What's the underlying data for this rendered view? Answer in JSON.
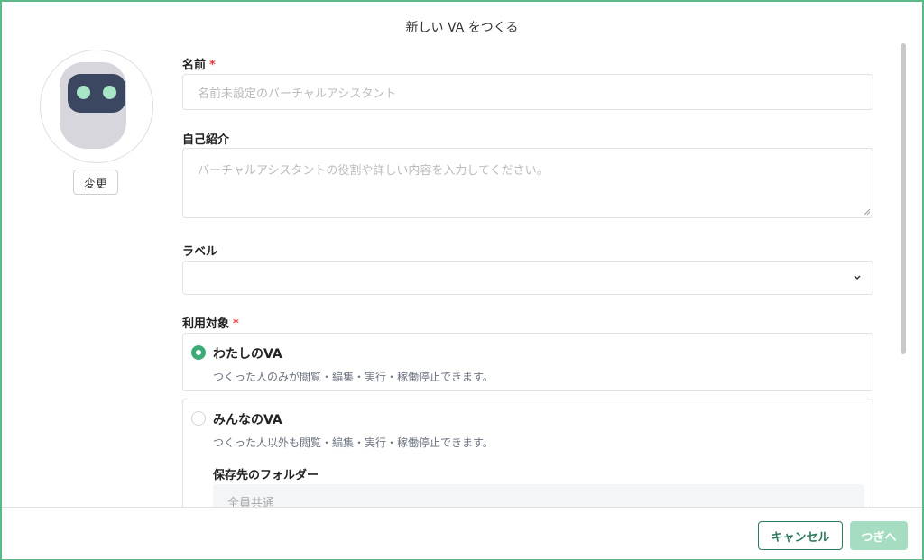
{
  "dialog": {
    "title": "新しい VA をつくる"
  },
  "avatar": {
    "change_label": "変更",
    "icon": "robot-avatar"
  },
  "form": {
    "name": {
      "label": "名前",
      "required_mark": "*",
      "value": "",
      "placeholder": "名前未設定のバーチャルアシスタント"
    },
    "intro": {
      "label": "自己紹介",
      "value": "",
      "placeholder": "バーチャルアシスタントの役割や詳しい内容を入力してください。"
    },
    "label_field": {
      "label": "ラベル",
      "selected": ""
    },
    "audience": {
      "label": "利用対象",
      "required_mark": "*",
      "options": [
        {
          "title": "わたしのVA",
          "description": "つくった人のみが閲覧・編集・実行・稼働停止できます。",
          "selected": true
        },
        {
          "title": "みんなのVA",
          "description": "つくった人以外も閲覧・編集・実行・稼働停止できます。",
          "selected": false,
          "folder_label": "保存先のフォルダー",
          "folder_value": "全員共通"
        }
      ]
    }
  },
  "footer": {
    "cancel_label": "キャンセル",
    "next_label": "つぎへ"
  },
  "colors": {
    "accent": "#3dab77",
    "frame_border": "#5cb88a",
    "required": "#e23b3b",
    "next_disabled": "#a6dcc2"
  }
}
